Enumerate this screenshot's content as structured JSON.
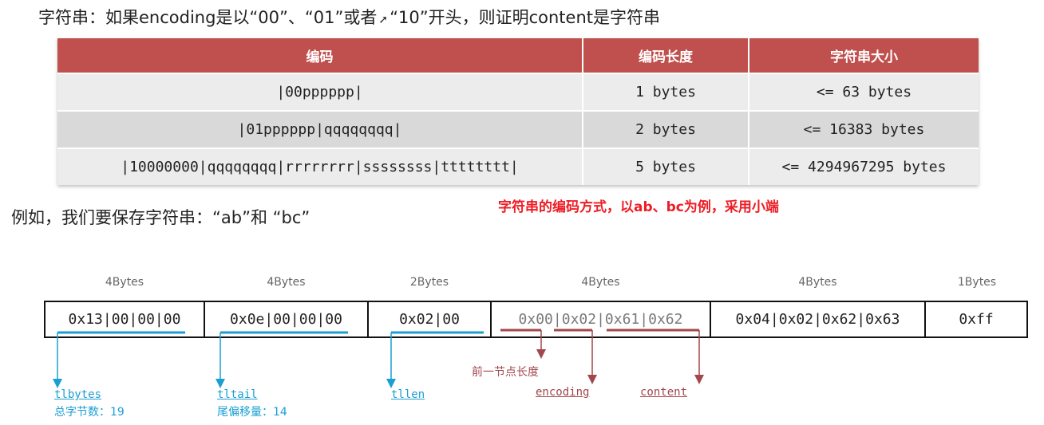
{
  "heading": {
    "prefix": "字符串：如果encoding是以“00”、“01”或者",
    "suffix": "“10”开头，则证明content是字符串"
  },
  "table": {
    "headers": [
      "编码",
      "编码长度",
      "字符串大小"
    ],
    "rows": [
      [
        "|00pppppp|",
        "1 bytes",
        "<= 63 bytes"
      ],
      [
        "|01pppppp|qqqqqqqq|",
        "2 bytes",
        "<= 16383 bytes"
      ],
      [
        "|10000000|qqqqqqqq|rrrrrrrr|ssssssss|tttttttt|",
        "5 bytes",
        "<= 4294967295 bytes"
      ]
    ]
  },
  "example_text": "例如，我们要保存字符串：“ab”和 “bc”",
  "note_text": "字符串的编码方式，以ab、bc为例，采用小端",
  "memory": {
    "sizes": [
      "4Bytes",
      "4Bytes",
      "2Bytes",
      "4Bytes",
      "4Bytes",
      "1Bytes"
    ],
    "cells": [
      "0x13|00|00|00",
      "0x0e|00|00|00",
      "0x02|00",
      "0x00|0x02|0x61|0x62",
      "0x04|0x02|0x62|0x63",
      "0xff"
    ]
  },
  "annotations": {
    "tlbytes": "tlbytes",
    "tlbytes_desc": "总字节数：19",
    "tltail": "tltail",
    "tltail_desc": "尾偏移量：14",
    "tllen": "tllen",
    "prev_len": "前一节点长度",
    "encoding": "encoding",
    "content": "content"
  },
  "colors": {
    "header_red": "#c0504d",
    "note_red": "#ee1c24",
    "annotation_blue": "#1a9fd3",
    "annotation_red": "#a2474c"
  }
}
